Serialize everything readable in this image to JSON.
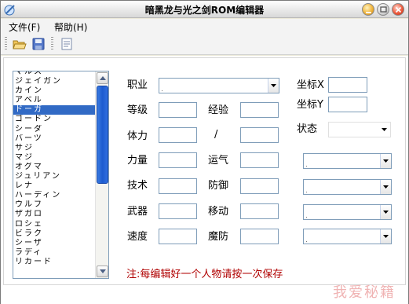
{
  "window": {
    "title": "暗黑龙与光之剑ROM编辑器"
  },
  "menu": {
    "file": "文件(F)",
    "help": "帮助(H)"
  },
  "toolbar": {
    "icons": [
      "open-folder-icon",
      "save-icon",
      "document-icon"
    ]
  },
  "list": {
    "items": [
      "マルス",
      "ジェイガン",
      "カイン",
      "アベル",
      "ドーガ",
      "ゴードン",
      "シーダ",
      "バーツ",
      "サジ",
      "マジ",
      "オグマ",
      "ジュリアン",
      "レナ",
      "ハーディン",
      "ウルフ",
      "ザガロ",
      "ロシェ",
      "ビラク",
      "シーザ",
      "ラディ",
      "リカード"
    ],
    "selected_index": 4
  },
  "form": {
    "class_label": "职业",
    "level_label": "等级",
    "exp_label": "经验",
    "hp_label": "体力",
    "slash": "/",
    "str_label": "力量",
    "luck_label": "运气",
    "skill_label": "技术",
    "def_label": "防御",
    "weapon_label": "武器",
    "move_label": "移动",
    "speed_label": "速度",
    "res_label": "魔防",
    "coord_x_label": "坐标X",
    "coord_y_label": "坐标Y",
    "status_label": "状态"
  },
  "note": "注:每编辑好一个人物请按一次保存",
  "watermark": "我爱秘籍",
  "colors": {
    "selection": "#316ac5",
    "note": "#b00000",
    "watermark": "#f0b4b4",
    "scroll_thumb": "#1c5bd0"
  }
}
